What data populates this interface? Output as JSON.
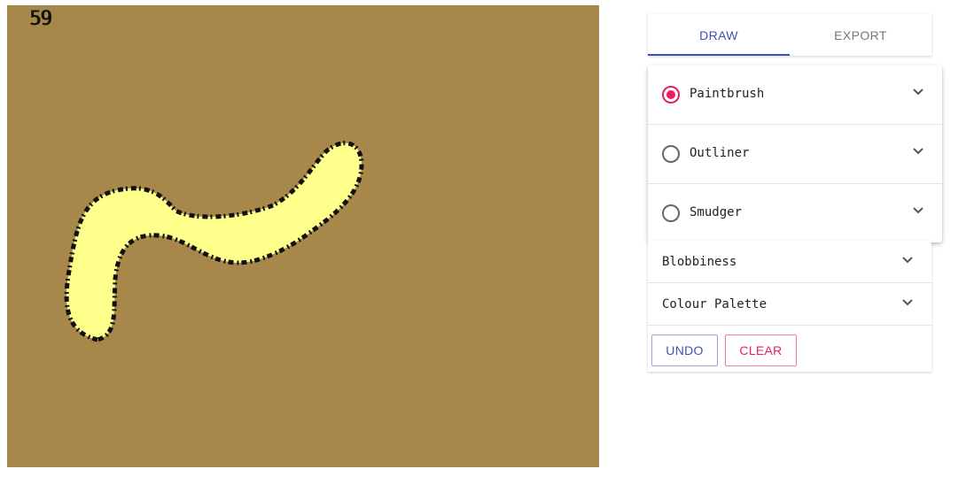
{
  "canvas": {
    "fps": "59",
    "background": "#a8884a",
    "stroke_fill": "#ffff8c",
    "stroke_outline": "#111111"
  },
  "tabs": [
    {
      "label": "DRAW",
      "active": true
    },
    {
      "label": "EXPORT",
      "active": false
    }
  ],
  "brushes": [
    {
      "label": "Paintbrush",
      "selected": true,
      "icon": "chevron-down-icon"
    },
    {
      "label": "Outliner",
      "selected": false,
      "icon": "chevron-down-icon"
    },
    {
      "label": "Smudger",
      "selected": false,
      "icon": "chevron-down-icon"
    }
  ],
  "sections": [
    {
      "label": "Blobbiness",
      "icon": "chevron-down-icon"
    },
    {
      "label": "Colour Palette",
      "icon": "chevron-down-icon"
    }
  ],
  "actions": {
    "undo_label": "UNDO",
    "clear_label": "CLEAR"
  },
  "colors": {
    "accent": "#3f51b5",
    "secondary": "#e91e63"
  }
}
